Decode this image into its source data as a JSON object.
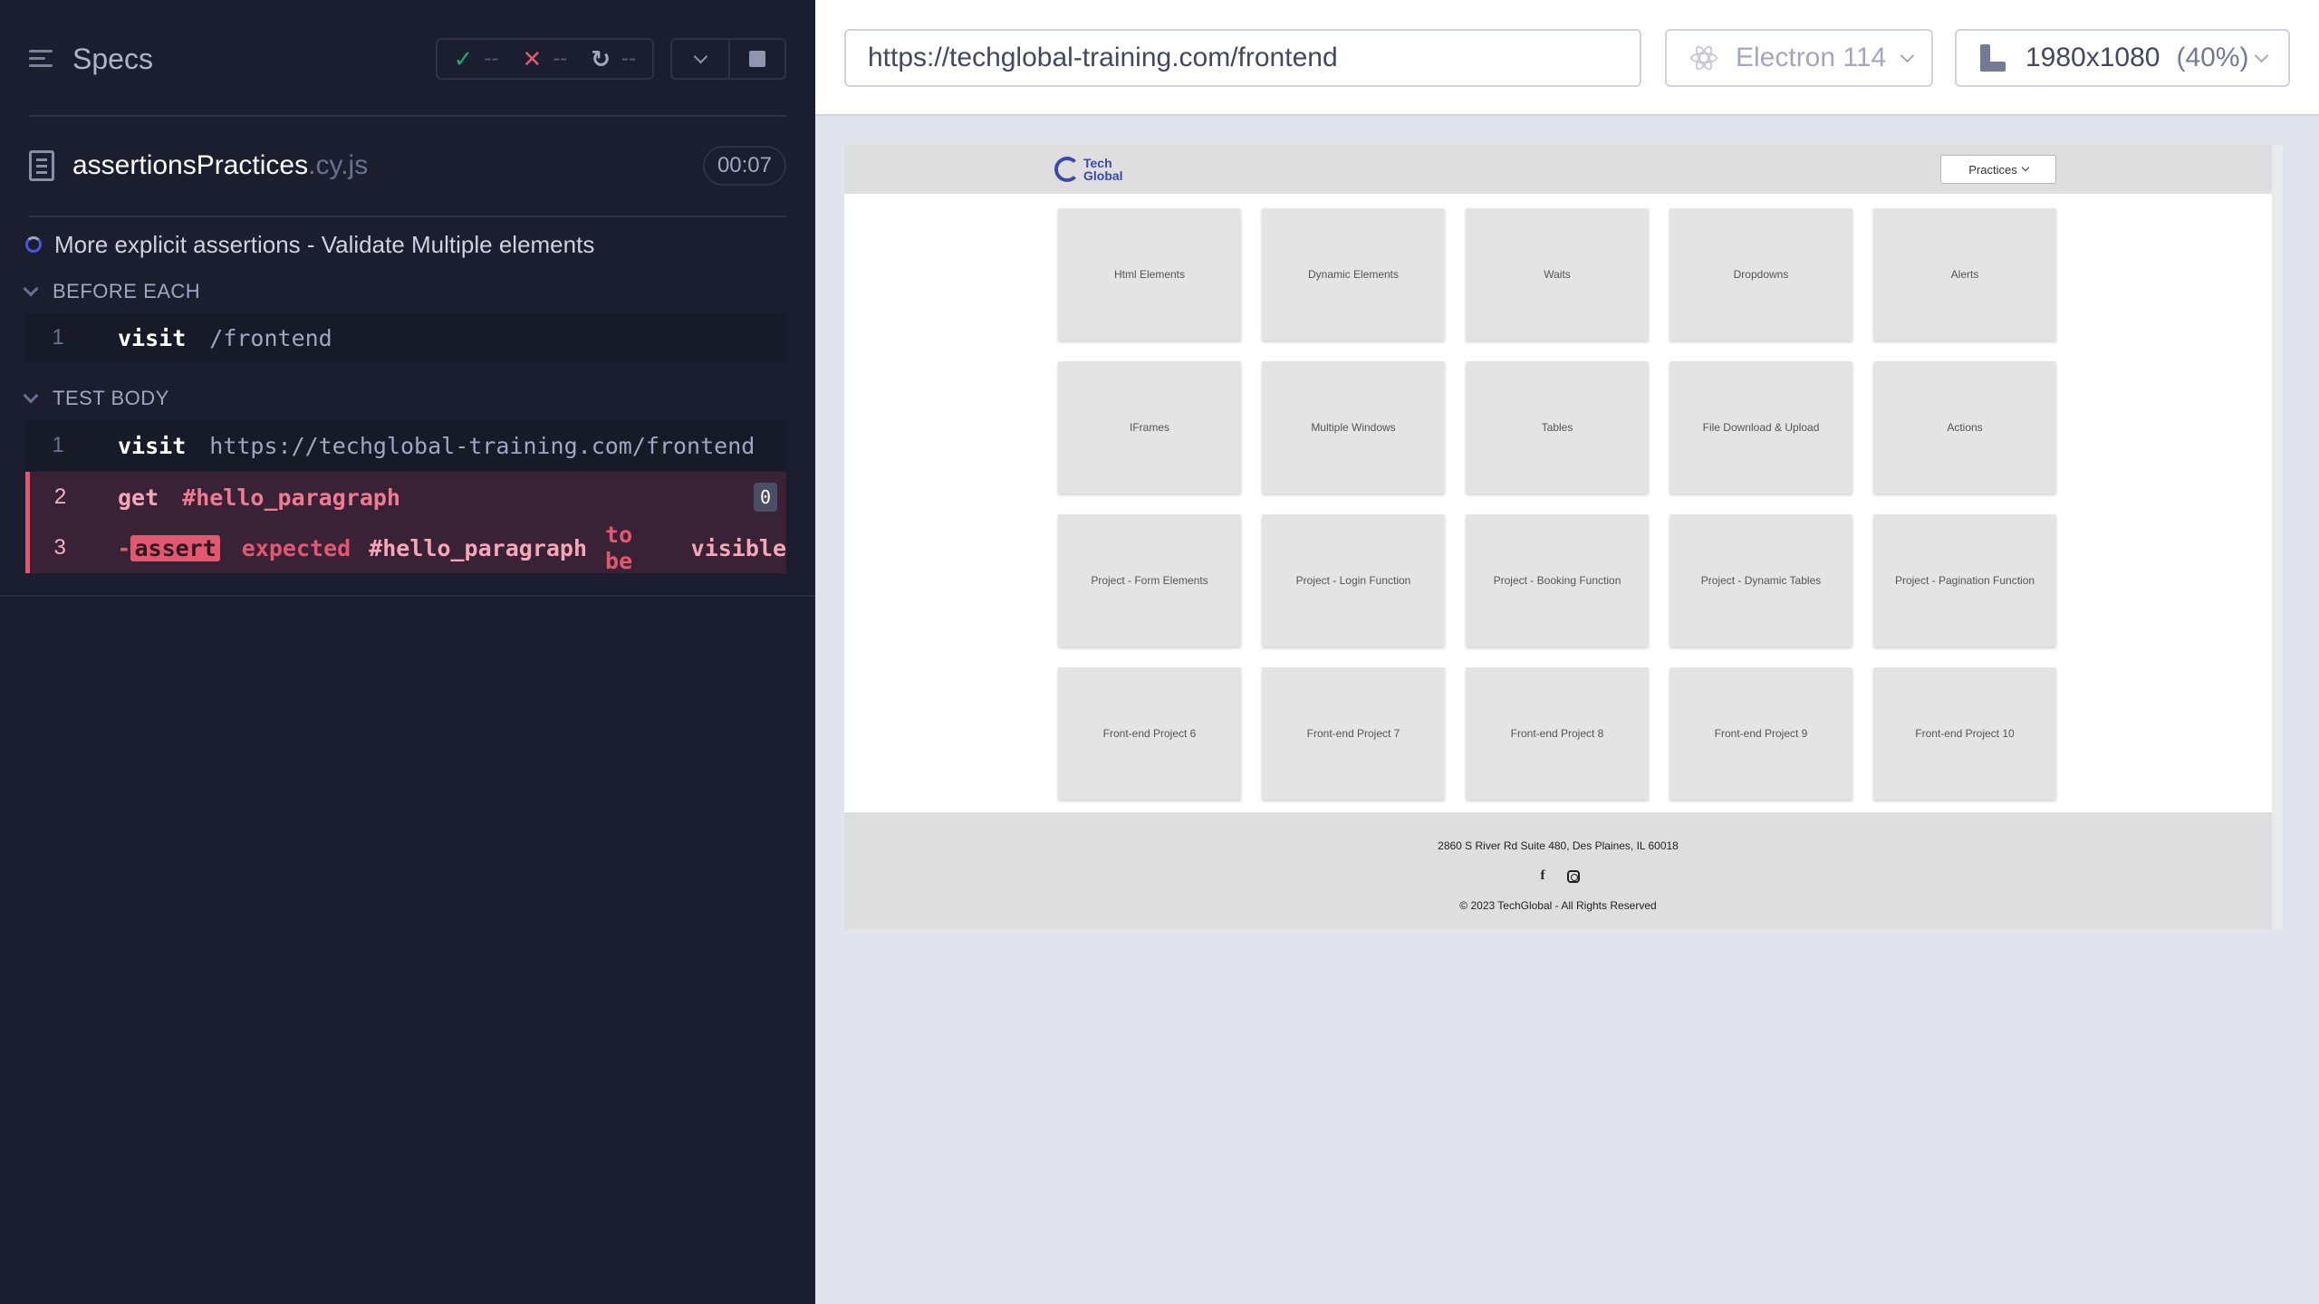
{
  "reporter": {
    "title": "Specs",
    "stats": {
      "passed": "--",
      "failed": "--",
      "pending": "--"
    },
    "spec": {
      "name": "assertionsPractices",
      "ext": ".cy.js",
      "duration": "00:07"
    },
    "test_title": "More explicit assertions - Validate Multiple elements",
    "hooks": {
      "before_each": {
        "label": "BEFORE EACH",
        "commands": [
          {
            "num": "1",
            "name": "visit",
            "arg": "/frontend"
          }
        ]
      },
      "test_body": {
        "label": "TEST BODY",
        "commands": [
          {
            "num": "1",
            "name": "visit",
            "arg": "https://techglobal-training.com/frontend"
          },
          {
            "num": "2",
            "name": "get",
            "arg": "#hello_paragraph",
            "badge": "0"
          },
          {
            "num": "3",
            "dash": "-",
            "name": "assert",
            "expected": "expected",
            "selector": "#hello_paragraph",
            "to_be": "to be",
            "state": "visible"
          }
        ]
      }
    }
  },
  "toolbar": {
    "url": "https://techglobal-training.com/frontend",
    "browser": "Electron 114",
    "viewport": "1980x1080",
    "zoom": "(40%)"
  },
  "aut": {
    "logo_line1": "Tech",
    "logo_line2": "Global",
    "practices_label": "Practices",
    "cards": [
      "Html Elements",
      "Dynamic Elements",
      "Waits",
      "Dropdowns",
      "Alerts",
      "IFrames",
      "Multiple Windows",
      "Tables",
      "File Download & Upload",
      "Actions",
      "Project - Form Elements",
      "Project - Login Function",
      "Project - Booking Function",
      "Project - Dynamic Tables",
      "Project - Pagination Function",
      "Front-end Project 6",
      "Front-end Project 7",
      "Front-end Project 8",
      "Front-end Project 9",
      "Front-end Project 10"
    ],
    "footer": {
      "address": "2860 S River Rd Suite 480, Des Plaines, IL 60018",
      "copyright": "© 2023 TechGlobal - All Rights Reserved"
    }
  },
  "colors": {
    "reporter_bg": "#1b1e2e",
    "fail_accent": "#e45770",
    "pass_accent": "#1fa971",
    "running_accent": "#4956e3"
  }
}
